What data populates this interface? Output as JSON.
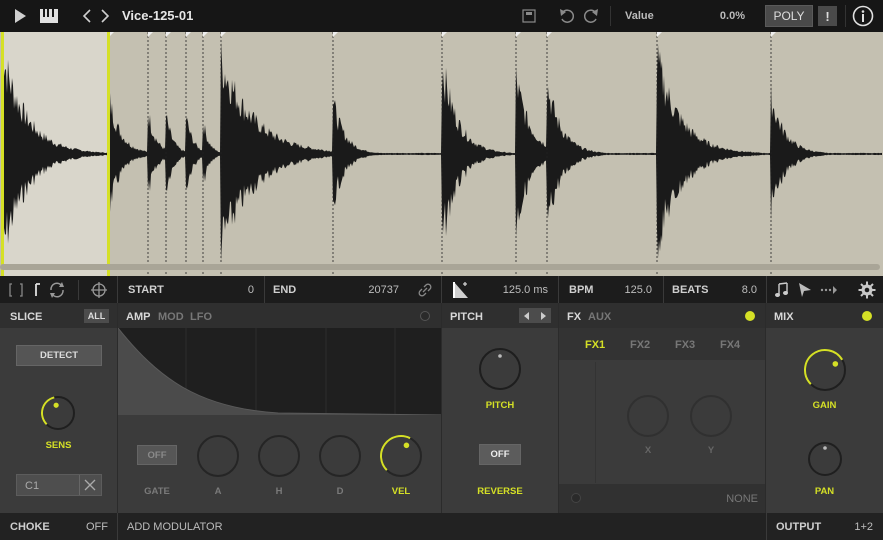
{
  "topbar": {
    "title": "Vice-125-01",
    "value_label": "Value",
    "value_pct": "0.0%",
    "poly_label": "POLY",
    "warn_label": "!",
    "info_label": "i"
  },
  "slicebar": {
    "start_label": "START",
    "start_value": "0",
    "end_label": "END",
    "end_value": "20737",
    "time_value": "125.0 ms",
    "bpm_label": "BPM",
    "bpm_value": "125.0",
    "beats_label": "BEATS",
    "beats_value": "8.0"
  },
  "slice_panel": {
    "title": "SLICE",
    "all_label": "ALL",
    "detect_label": "DETECT",
    "sens_label": "SENS",
    "sens_level": 0.45,
    "note_value": "C1"
  },
  "amp_panel": {
    "tabs": [
      "AMP",
      "MOD",
      "LFO"
    ],
    "gate_toggle": "OFF",
    "gate_label": "GATE",
    "knobs": [
      "A",
      "H",
      "D",
      "VEL"
    ],
    "vel_level": 0.6
  },
  "pitch_panel": {
    "title": "PITCH",
    "pitch_label": "PITCH",
    "reverse_toggle": "OFF",
    "reverse_label": "REVERSE"
  },
  "fx_panel": {
    "tabs": [
      "FX",
      "AUX"
    ],
    "slots": [
      "FX1",
      "FX2",
      "FX3",
      "FX4"
    ],
    "x_label": "X",
    "y_label": "Y",
    "none_label": "NONE"
  },
  "mix_panel": {
    "title": "MIX",
    "gain_label": "GAIN",
    "gain_level": 0.72,
    "pan_label": "PAN"
  },
  "bottombar": {
    "choke_label": "CHOKE",
    "choke_value": "OFF",
    "add_mod_label": "ADD MODULATOR",
    "output_label": "OUTPUT",
    "output_value": "1+2"
  },
  "colors": {
    "accent": "#d5e026",
    "wave_bg": "#c4c0b1",
    "wave_selected": "#d9d6cb",
    "waveform": "#1a1a1a"
  }
}
